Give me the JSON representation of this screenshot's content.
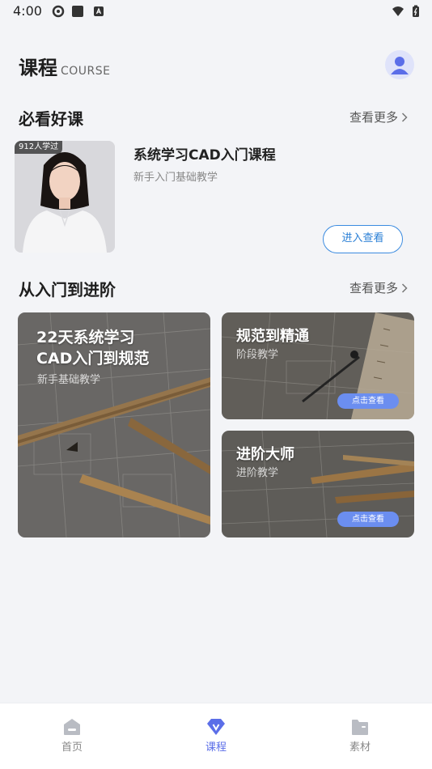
{
  "status_bar": {
    "time": "4:00"
  },
  "header": {
    "title": "课程",
    "title_en": "COURSE"
  },
  "section_recommended": {
    "title": "必看好课",
    "more_label": "查看更多"
  },
  "featured_course": {
    "badge": "912人学过",
    "title": "系统学习CAD入门课程",
    "subtitle": "新手入门基础教学",
    "button_label": "进入查看"
  },
  "section_advanced": {
    "title": "从入门到进阶",
    "more_label": "查看更多"
  },
  "course_cards": [
    {
      "title_line1": "22天系统学习",
      "title_line2": "CAD入门到规范",
      "subtitle": "新手基础教学"
    },
    {
      "title": "规范到精通",
      "subtitle": "阶段教学",
      "button_label": "点击查看"
    },
    {
      "title": "进阶大师",
      "subtitle": "进阶教学",
      "button_label": "点击查看"
    }
  ],
  "bottom_nav": {
    "items": [
      {
        "label": "首页",
        "icon": "home-icon"
      },
      {
        "label": "课程",
        "icon": "course-v-icon"
      },
      {
        "label": "素材",
        "icon": "folder-icon"
      }
    ],
    "active_index": 1,
    "active_color": "#5b6ee8"
  },
  "colors": {
    "accent": "#5b6ee8",
    "button_border": "#3b8be0",
    "pill": "#6b8ef0"
  }
}
